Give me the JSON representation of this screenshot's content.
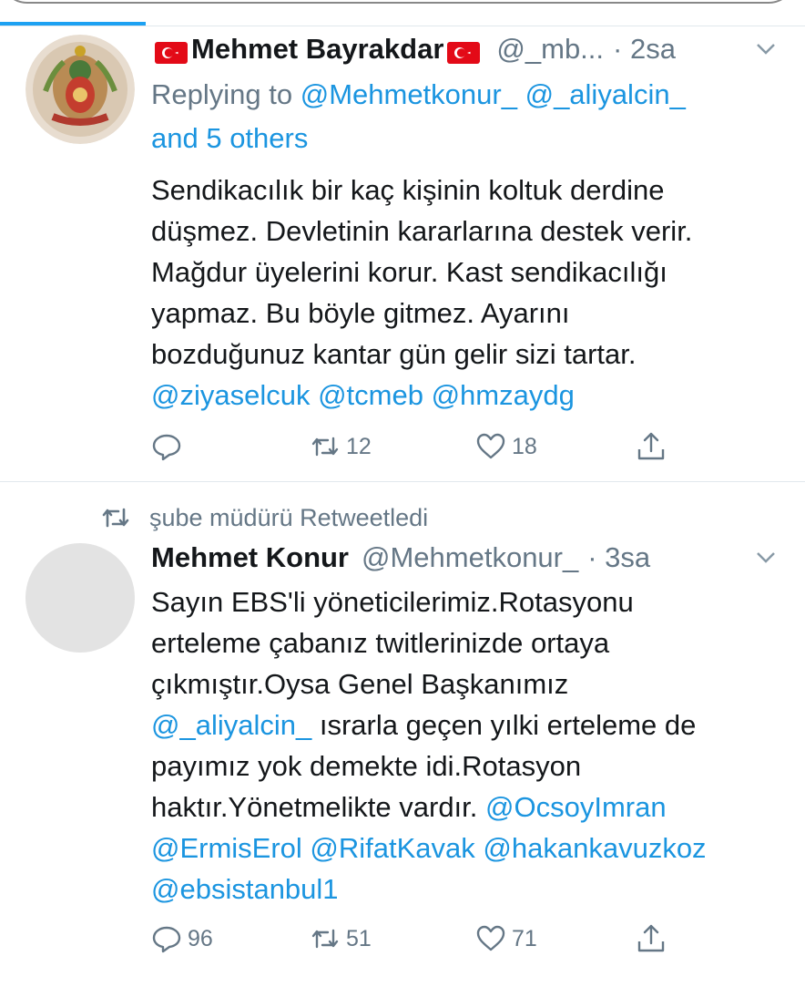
{
  "tweet1": {
    "name": "Mehmet Bayrakdar",
    "handle": "@_mb...",
    "time": "· 2sa",
    "reply_prefix": "Replying to",
    "reply_mention_1": "@Mehmetkonur_",
    "reply_mention_2": "@_aliyalcin_",
    "reply_others": "and 5 others",
    "text_lines": [
      "Sendikacılık bir kaç kişinin koltuk derdine",
      "düşmez. Devletinin kararlarına destek verir.",
      "Mağdur üyelerini korur. Kast sendikacılığı",
      "yapmaz. Bu böyle gitmez. Ayarını",
      "bozduğunuz kantar gün gelir sizi tartar."
    ],
    "mentions": "@ziyaselcuk @tcmeb @hmzaydg",
    "retweets": "12",
    "likes": "18",
    "icons": [
      "reply-icon",
      "retweet-icon",
      "like-icon",
      "share-icon"
    ]
  },
  "retweet_banner": {
    "text": "şube müdürü Retweetledi"
  },
  "tweet2": {
    "name": "Mehmet Konur",
    "handle": "@Mehmetkonur_",
    "time": "· 3sa",
    "line1": "Sayın EBS'li yöneticilerimiz.Rotasyonu",
    "line2": "erteleme çabanız twitlerinizde ortaya",
    "line3": "çıkmıştır.Oysa Genel Başkanımız",
    "line4_mention": "@_aliyalcin_",
    "line4_text": " ısrarla geçen yılki erteleme de",
    "line5": "payımız yok demekte idi.Rotasyon",
    "line6_text": "haktır.Yönetmelikte vardır. ",
    "line6_mention": "@OcsoyImran",
    "line7_mentions": "@ErmisErol @RifatKavak @hakankavuzkoz",
    "line8_mentions": "@ebsistanbul1",
    "replies": "96",
    "retweets": "51",
    "likes": "71"
  },
  "colors": {
    "link": "#1b95e0",
    "muted": "#657786",
    "text": "#14171a",
    "accent": "#1da1f2"
  }
}
